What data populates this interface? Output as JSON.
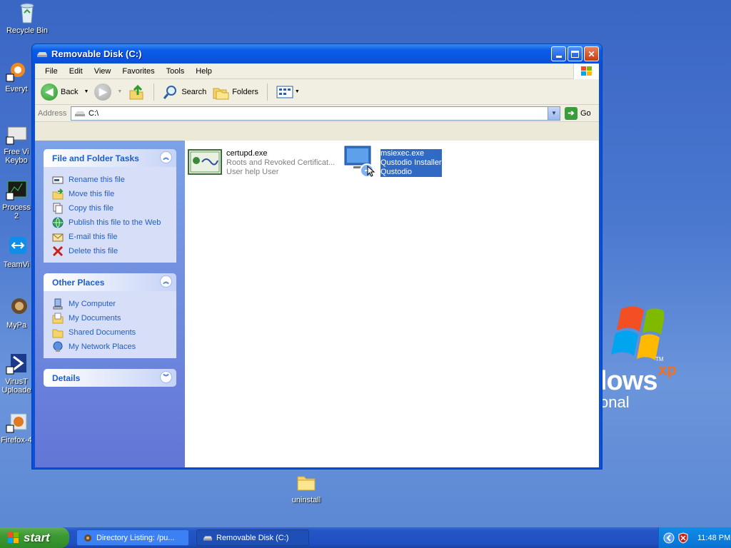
{
  "desktop": {
    "icons": [
      {
        "label": "Recycle Bin"
      },
      {
        "label": "Everyt"
      },
      {
        "label": "Free Vi Keybo"
      },
      {
        "label": "Process 2"
      },
      {
        "label": "TeamVi"
      },
      {
        "label": "MyPa"
      },
      {
        "label": "VirusT Uploade"
      },
      {
        "label": "Firefox-4"
      },
      {
        "label": "uninstall"
      }
    ],
    "logo": {
      "text1": "lows",
      "sup": "xp",
      "tm": "TM",
      "text2": "onal"
    }
  },
  "window": {
    "title": "Removable Disk (C:)",
    "menu": [
      "File",
      "Edit",
      "View",
      "Favorites",
      "Tools",
      "Help"
    ],
    "toolbar": {
      "back": "Back",
      "search": "Search",
      "folders": "Folders"
    },
    "address": {
      "label": "Address",
      "value": "C:\\",
      "go": "Go"
    },
    "tasks_panel": {
      "title": "File and Folder Tasks",
      "items": [
        "Rename this file",
        "Move this file",
        "Copy this file",
        "Publish this file to the Web",
        "E-mail this file",
        "Delete this file"
      ]
    },
    "places_panel": {
      "title": "Other Places",
      "items": [
        "My Computer",
        "My Documents",
        "Shared Documents",
        "My Network Places"
      ]
    },
    "details_panel": {
      "title": "Details"
    },
    "files": [
      {
        "name": "certupd.exe",
        "desc": "Roots and Revoked Certificat...",
        "company": "User help User"
      },
      {
        "name": "msiexec.exe",
        "desc": "Qustodio Installer",
        "company": "Qustodio"
      }
    ]
  },
  "taskbar": {
    "start": "start",
    "tasks": [
      "Directory Listing: /pu...",
      "Removable Disk (C:)"
    ],
    "clock": "11:48 PM"
  }
}
